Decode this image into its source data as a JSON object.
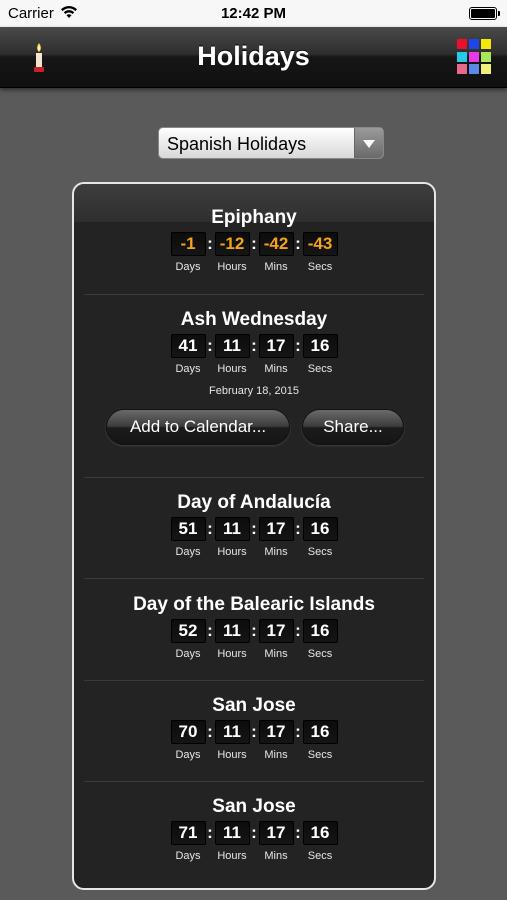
{
  "status_bar": {
    "carrier": "Carrier",
    "time": "12:42 PM"
  },
  "nav": {
    "title": "Holidays"
  },
  "dropdown": {
    "selected": "Spanish Holidays"
  },
  "units": {
    "days": "Days",
    "hours": "Hours",
    "mins": "Mins",
    "secs": "Secs"
  },
  "colors": {
    "past_value": "#f3a417",
    "grid_icon": [
      "#e8102a",
      "#2045e8",
      "#f3e80c",
      "#28c8e8",
      "#e63ce8",
      "#a8e85a",
      "#e86a8a",
      "#5a8ae8",
      "#f0f07a"
    ]
  },
  "holidays": [
    {
      "name": "Epiphany",
      "days": "-1",
      "hours": "-12",
      "mins": "-42",
      "secs": "-43"
    },
    {
      "name": "Ash Wednesday",
      "days": "41",
      "hours": "11",
      "mins": "17",
      "secs": "16",
      "date": "February 18, 2015"
    },
    {
      "name": "Day of Andalucía",
      "days": "51",
      "hours": "11",
      "mins": "17",
      "secs": "16"
    },
    {
      "name": "Day of the Balearic Islands",
      "days": "52",
      "hours": "11",
      "mins": "17",
      "secs": "16"
    },
    {
      "name": "San Jose",
      "days": "70",
      "hours": "11",
      "mins": "17",
      "secs": "16"
    },
    {
      "name": "San Jose",
      "days": "71",
      "hours": "11",
      "mins": "17",
      "secs": "16"
    }
  ],
  "actions": {
    "add_to_calendar": "Add to Calendar...",
    "share": "Share..."
  }
}
